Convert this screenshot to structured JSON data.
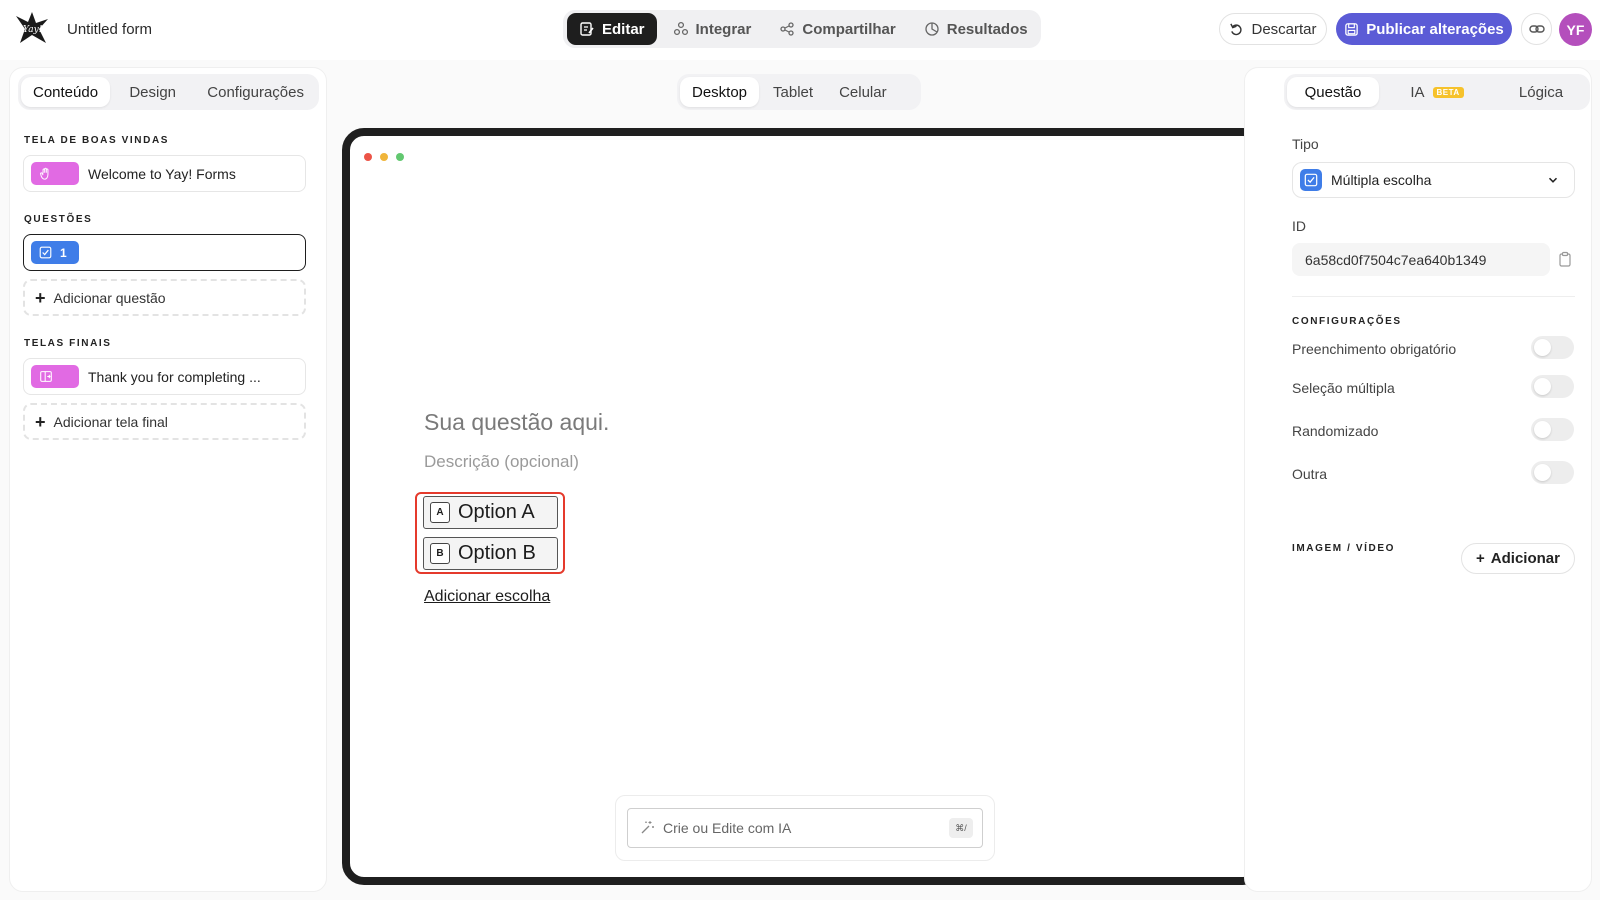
{
  "header": {
    "form_title": "Untitled form",
    "tabs": [
      {
        "label": "Editar",
        "icon": "edit-icon",
        "active": true
      },
      {
        "label": "Integrar",
        "icon": "integrate-icon",
        "active": false
      },
      {
        "label": "Compartilhar",
        "icon": "share-icon",
        "active": false
      },
      {
        "label": "Resultados",
        "icon": "results-icon",
        "active": false
      }
    ],
    "discard_label": "Descartar",
    "publish_label": "Publicar alterações",
    "avatar_initials": "YF"
  },
  "left_panel": {
    "tabs": [
      {
        "label": "Conteúdo",
        "active": true
      },
      {
        "label": "Design",
        "active": false
      },
      {
        "label": "Configurações",
        "active": false
      }
    ],
    "welcome_section_label": "TELA DE BOAS VINDAS",
    "welcome_item": "Welcome to Yay! Forms",
    "questions_section_label": "QUESTÕES",
    "question_item_number": "1",
    "add_question_label": "Adicionar questão",
    "end_section_label": "TELAS FINAIS",
    "end_item": "Thank you for completing ...",
    "add_end_label": "Adicionar tela final"
  },
  "preview": {
    "device_tabs": [
      {
        "label": "Desktop",
        "active": true
      },
      {
        "label": "Tablet",
        "active": false
      },
      {
        "label": "Celular",
        "active": false
      }
    ],
    "question_placeholder": "Sua questão aqui.",
    "description_placeholder": "Descrição (opcional)",
    "options": [
      {
        "key": "A",
        "label": "Option A"
      },
      {
        "key": "B",
        "label": "Option B"
      }
    ],
    "add_choice_label": "Adicionar escolha",
    "ai_placeholder": "Crie ou Edite com IA",
    "ai_shortcut": "⌘/"
  },
  "right_panel": {
    "tabs": [
      {
        "label": "Questão",
        "active": true
      },
      {
        "label": "IA",
        "badge": "BETA",
        "active": false
      },
      {
        "label": "Lógica",
        "active": false
      }
    ],
    "type_label": "Tipo",
    "type_value": "Múltipla escolha",
    "id_label": "ID",
    "id_value": "6a58cd0f7504c7ea640b1349",
    "settings_section_label": "CONFIGURAÇÕES",
    "settings": [
      {
        "label": "Preenchimento obrigatório",
        "enabled": false
      },
      {
        "label": "Seleção múltipla",
        "enabled": false
      },
      {
        "label": "Randomizado",
        "enabled": false
      },
      {
        "label": "Outra",
        "enabled": false
      }
    ],
    "media_section_label": "IMAGEM / VÍDEO",
    "add_media_label": "Adicionar"
  },
  "colors": {
    "accent": "#5b5bd6",
    "avatar": "#b44fbc",
    "chip_pink": "#e16ae3",
    "chip_blue": "#3f7de8",
    "highlight_red": "#e53a2c",
    "beta_badge": "#f6c22b"
  }
}
